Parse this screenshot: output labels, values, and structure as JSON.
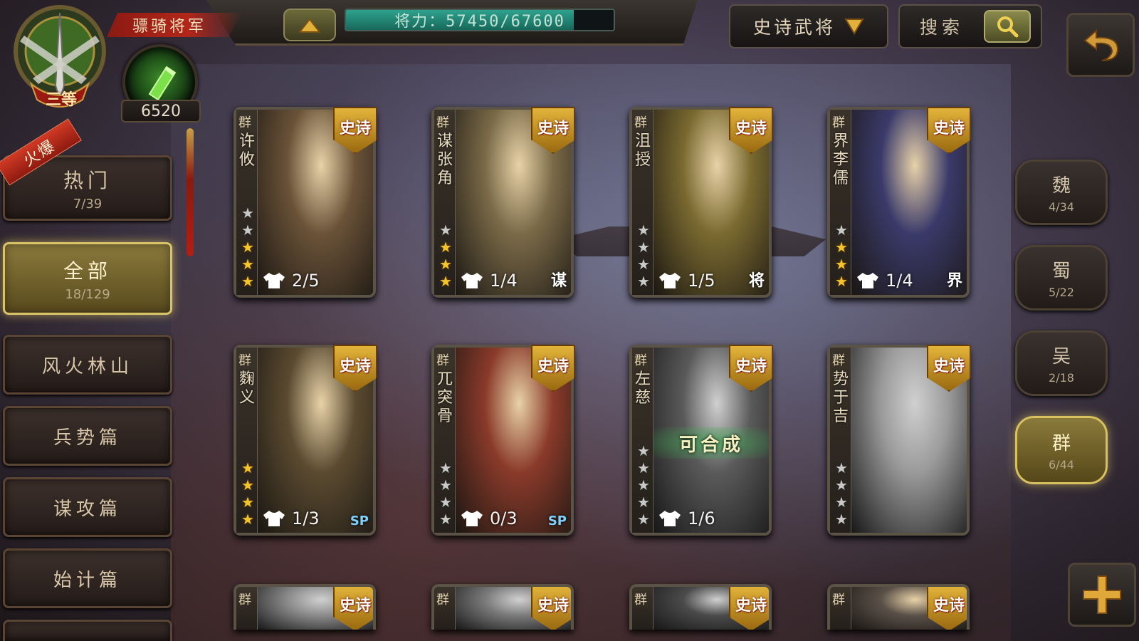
{
  "rank": {
    "level_label": "三等",
    "title": "骠骑将军"
  },
  "energy": {
    "value": "6520"
  },
  "power": {
    "text": "将力：57450/67600",
    "fraction": 0.85
  },
  "filter": {
    "selected": "史诗武将"
  },
  "search": {
    "label": "搜索"
  },
  "sidebar": {
    "hot_ribbon": "火爆",
    "items": [
      {
        "label": "热门",
        "count": "7/39"
      },
      {
        "label": "全部",
        "count": "18/129"
      },
      {
        "label": "风火林山",
        "count": ""
      },
      {
        "label": "兵势篇",
        "count": ""
      },
      {
        "label": "谋攻篇",
        "count": ""
      },
      {
        "label": "始计篇",
        "count": ""
      }
    ]
  },
  "factions": [
    {
      "name": "魏",
      "count": "4/34"
    },
    {
      "name": "蜀",
      "count": "5/22"
    },
    {
      "name": "吴",
      "count": "2/18"
    },
    {
      "name": "群",
      "count": "6/44"
    }
  ],
  "colors": {
    "gold": "#f4c52a",
    "accent_active": "#d8c36a",
    "power_fill": "#2fa28e"
  },
  "cards": [
    {
      "faction": "群",
      "name": "许攸",
      "badge": "史诗",
      "skins": "2/5",
      "tag": "",
      "gold_stars": 3,
      "grey_stars": 2,
      "portrait_hue": "#6a5238",
      "greyscale": false,
      "synth": ""
    },
    {
      "faction": "群",
      "name": "谋张角",
      "badge": "史诗",
      "skins": "1/4",
      "tag": "谋",
      "gold_stars": 3,
      "grey_stars": 1,
      "portrait_hue": "#7a6a48",
      "greyscale": false,
      "synth": ""
    },
    {
      "faction": "群",
      "name": "沮授",
      "badge": "史诗",
      "skins": "1/5",
      "tag": "将",
      "gold_stars": 0,
      "grey_stars": 4,
      "portrait_hue": "#7a6a30",
      "greyscale": false,
      "synth": ""
    },
    {
      "faction": "群",
      "name": "界李儒",
      "badge": "史诗",
      "skins": "1/4",
      "tag": "界",
      "gold_stars": 3,
      "grey_stars": 1,
      "portrait_hue": "#3a3a6a",
      "greyscale": false,
      "synth": ""
    },
    {
      "faction": "群",
      "name": "麴义",
      "badge": "史诗",
      "skins": "1/3",
      "tag": "SP",
      "gold_stars": 4,
      "grey_stars": 0,
      "portrait_hue": "#5a4a30",
      "greyscale": false,
      "synth": ""
    },
    {
      "faction": "群",
      "name": "兀突骨",
      "badge": "史诗",
      "skins": "0/3",
      "tag": "SP",
      "gold_stars": 0,
      "grey_stars": 4,
      "portrait_hue": "#8a3a2a",
      "greyscale": false,
      "synth": ""
    },
    {
      "faction": "群",
      "name": "左慈",
      "badge": "史诗",
      "skins": "1/6",
      "tag": "",
      "gold_stars": 0,
      "grey_stars": 5,
      "portrait_hue": "#5a5a5a",
      "greyscale": true,
      "synth": "可合成"
    },
    {
      "faction": "群",
      "name": "势于吉",
      "badge": "史诗",
      "skins": "",
      "tag": "",
      "gold_stars": 0,
      "grey_stars": 4,
      "portrait_hue": "#9a9a9a",
      "greyscale": true,
      "synth": ""
    },
    {
      "faction": "群",
      "name": "",
      "badge": "史诗",
      "skins": "",
      "tag": "",
      "gold_stars": 0,
      "grey_stars": 0,
      "portrait_hue": "#8a8a8a",
      "greyscale": true,
      "synth": ""
    },
    {
      "faction": "群",
      "name": "",
      "badge": "史诗",
      "skins": "",
      "tag": "",
      "gold_stars": 0,
      "grey_stars": 0,
      "portrait_hue": "#7a7a7a",
      "greyscale": true,
      "synth": ""
    },
    {
      "faction": "群",
      "name": "",
      "badge": "史诗",
      "skins": "",
      "tag": "",
      "gold_stars": 0,
      "grey_stars": 0,
      "portrait_hue": "#4a4a4a",
      "greyscale": true,
      "synth": ""
    },
    {
      "faction": "群",
      "name": "",
      "badge": "史诗",
      "skins": "",
      "tag": "",
      "gold_stars": 0,
      "grey_stars": 0,
      "portrait_hue": "#5a5048",
      "greyscale": false,
      "synth": ""
    }
  ]
}
